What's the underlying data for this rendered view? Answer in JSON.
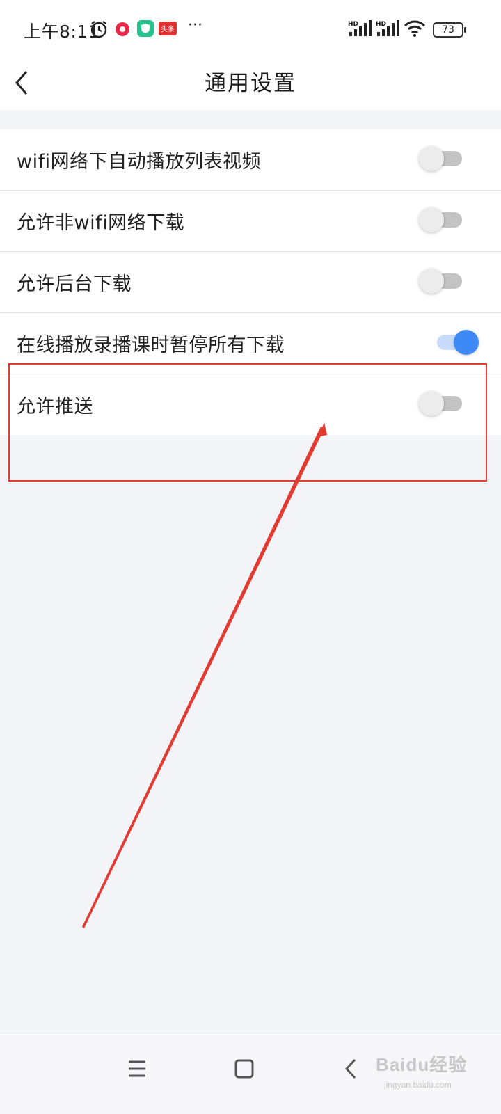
{
  "status_bar": {
    "time": "上午8:11",
    "icons": [
      "alarm-icon",
      "app-red-icon",
      "app-green-shield-icon",
      "toutiao-icon",
      "more-icon",
      "signal-hd-icon",
      "signal-hd-icon",
      "wifi-icon"
    ],
    "toutiao_label": "头条",
    "more": "···",
    "hd_label": "HD",
    "battery": "73"
  },
  "header": {
    "title": "通用设置"
  },
  "settings": [
    {
      "label": "wifi网络下自动播放列表视频",
      "enabled": false
    },
    {
      "label": "允许非wifi网络下载",
      "enabled": false
    },
    {
      "label": "允许后台下载",
      "enabled": false
    },
    {
      "label": "在线播放录播课时暂停所有下载",
      "enabled": true
    },
    {
      "label": "允许推送",
      "enabled": false
    }
  ],
  "colors": {
    "accent": "#3d8af7",
    "annotation": "#e23b32",
    "background": "#f3f4f8"
  },
  "watermark": {
    "brand": "Baidu经验",
    "url": "jingyan.baidu.com"
  }
}
